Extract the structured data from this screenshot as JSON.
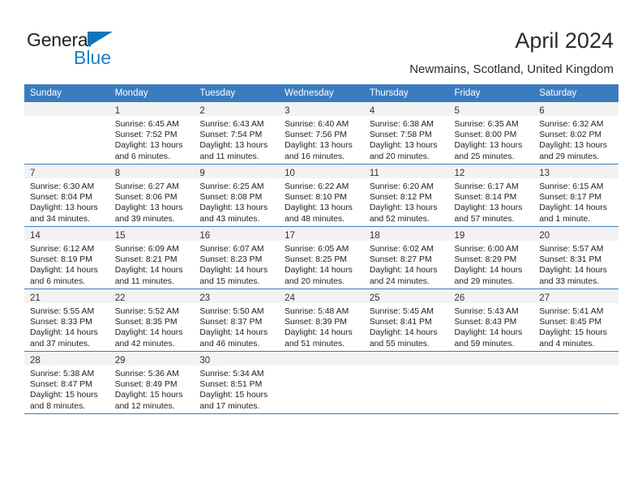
{
  "brand": {
    "name_part1": "General",
    "name_part2": "Blue",
    "triangle_color": "#1275bc",
    "text_color_primary": "#222222",
    "text_color_accent": "#1f7dc4"
  },
  "header": {
    "title": "April 2024",
    "subtitle": "Newmains, Scotland, United Kingdom"
  },
  "theme": {
    "header_row_bg": "#3b7cbf",
    "header_row_text": "#ffffff",
    "daynum_band_bg": "#f2f2f2",
    "cell_border": "#3b7cbf",
    "page_bg": "#ffffff"
  },
  "weekdays": [
    "Sunday",
    "Monday",
    "Tuesday",
    "Wednesday",
    "Thursday",
    "Friday",
    "Saturday"
  ],
  "labels": {
    "sunrise_prefix": "Sunrise:",
    "sunset_prefix": "Sunset:",
    "daylight_prefix": "Daylight:"
  },
  "weeks": [
    [
      {
        "empty": true
      },
      {
        "empty": false,
        "day": "1",
        "sunrise": "Sunrise: 6:45 AM",
        "sunset": "Sunset: 7:52 PM",
        "daylight_line1": "Daylight: 13 hours",
        "daylight_line2": "and 6 minutes."
      },
      {
        "empty": false,
        "day": "2",
        "sunrise": "Sunrise: 6:43 AM",
        "sunset": "Sunset: 7:54 PM",
        "daylight_line1": "Daylight: 13 hours",
        "daylight_line2": "and 11 minutes."
      },
      {
        "empty": false,
        "day": "3",
        "sunrise": "Sunrise: 6:40 AM",
        "sunset": "Sunset: 7:56 PM",
        "daylight_line1": "Daylight: 13 hours",
        "daylight_line2": "and 16 minutes."
      },
      {
        "empty": false,
        "day": "4",
        "sunrise": "Sunrise: 6:38 AM",
        "sunset": "Sunset: 7:58 PM",
        "daylight_line1": "Daylight: 13 hours",
        "daylight_line2": "and 20 minutes."
      },
      {
        "empty": false,
        "day": "5",
        "sunrise": "Sunrise: 6:35 AM",
        "sunset": "Sunset: 8:00 PM",
        "daylight_line1": "Daylight: 13 hours",
        "daylight_line2": "and 25 minutes."
      },
      {
        "empty": false,
        "day": "6",
        "sunrise": "Sunrise: 6:32 AM",
        "sunset": "Sunset: 8:02 PM",
        "daylight_line1": "Daylight: 13 hours",
        "daylight_line2": "and 29 minutes."
      }
    ],
    [
      {
        "empty": false,
        "day": "7",
        "sunrise": "Sunrise: 6:30 AM",
        "sunset": "Sunset: 8:04 PM",
        "daylight_line1": "Daylight: 13 hours",
        "daylight_line2": "and 34 minutes."
      },
      {
        "empty": false,
        "day": "8",
        "sunrise": "Sunrise: 6:27 AM",
        "sunset": "Sunset: 8:06 PM",
        "daylight_line1": "Daylight: 13 hours",
        "daylight_line2": "and 39 minutes."
      },
      {
        "empty": false,
        "day": "9",
        "sunrise": "Sunrise: 6:25 AM",
        "sunset": "Sunset: 8:08 PM",
        "daylight_line1": "Daylight: 13 hours",
        "daylight_line2": "and 43 minutes."
      },
      {
        "empty": false,
        "day": "10",
        "sunrise": "Sunrise: 6:22 AM",
        "sunset": "Sunset: 8:10 PM",
        "daylight_line1": "Daylight: 13 hours",
        "daylight_line2": "and 48 minutes."
      },
      {
        "empty": false,
        "day": "11",
        "sunrise": "Sunrise: 6:20 AM",
        "sunset": "Sunset: 8:12 PM",
        "daylight_line1": "Daylight: 13 hours",
        "daylight_line2": "and 52 minutes."
      },
      {
        "empty": false,
        "day": "12",
        "sunrise": "Sunrise: 6:17 AM",
        "sunset": "Sunset: 8:14 PM",
        "daylight_line1": "Daylight: 13 hours",
        "daylight_line2": "and 57 minutes."
      },
      {
        "empty": false,
        "day": "13",
        "sunrise": "Sunrise: 6:15 AM",
        "sunset": "Sunset: 8:17 PM",
        "daylight_line1": "Daylight: 14 hours",
        "daylight_line2": "and 1 minute."
      }
    ],
    [
      {
        "empty": false,
        "day": "14",
        "sunrise": "Sunrise: 6:12 AM",
        "sunset": "Sunset: 8:19 PM",
        "daylight_line1": "Daylight: 14 hours",
        "daylight_line2": "and 6 minutes."
      },
      {
        "empty": false,
        "day": "15",
        "sunrise": "Sunrise: 6:09 AM",
        "sunset": "Sunset: 8:21 PM",
        "daylight_line1": "Daylight: 14 hours",
        "daylight_line2": "and 11 minutes."
      },
      {
        "empty": false,
        "day": "16",
        "sunrise": "Sunrise: 6:07 AM",
        "sunset": "Sunset: 8:23 PM",
        "daylight_line1": "Daylight: 14 hours",
        "daylight_line2": "and 15 minutes."
      },
      {
        "empty": false,
        "day": "17",
        "sunrise": "Sunrise: 6:05 AM",
        "sunset": "Sunset: 8:25 PM",
        "daylight_line1": "Daylight: 14 hours",
        "daylight_line2": "and 20 minutes."
      },
      {
        "empty": false,
        "day": "18",
        "sunrise": "Sunrise: 6:02 AM",
        "sunset": "Sunset: 8:27 PM",
        "daylight_line1": "Daylight: 14 hours",
        "daylight_line2": "and 24 minutes."
      },
      {
        "empty": false,
        "day": "19",
        "sunrise": "Sunrise: 6:00 AM",
        "sunset": "Sunset: 8:29 PM",
        "daylight_line1": "Daylight: 14 hours",
        "daylight_line2": "and 29 minutes."
      },
      {
        "empty": false,
        "day": "20",
        "sunrise": "Sunrise: 5:57 AM",
        "sunset": "Sunset: 8:31 PM",
        "daylight_line1": "Daylight: 14 hours",
        "daylight_line2": "and 33 minutes."
      }
    ],
    [
      {
        "empty": false,
        "day": "21",
        "sunrise": "Sunrise: 5:55 AM",
        "sunset": "Sunset: 8:33 PM",
        "daylight_line1": "Daylight: 14 hours",
        "daylight_line2": "and 37 minutes."
      },
      {
        "empty": false,
        "day": "22",
        "sunrise": "Sunrise: 5:52 AM",
        "sunset": "Sunset: 8:35 PM",
        "daylight_line1": "Daylight: 14 hours",
        "daylight_line2": "and 42 minutes."
      },
      {
        "empty": false,
        "day": "23",
        "sunrise": "Sunrise: 5:50 AM",
        "sunset": "Sunset: 8:37 PM",
        "daylight_line1": "Daylight: 14 hours",
        "daylight_line2": "and 46 minutes."
      },
      {
        "empty": false,
        "day": "24",
        "sunrise": "Sunrise: 5:48 AM",
        "sunset": "Sunset: 8:39 PM",
        "daylight_line1": "Daylight: 14 hours",
        "daylight_line2": "and 51 minutes."
      },
      {
        "empty": false,
        "day": "25",
        "sunrise": "Sunrise: 5:45 AM",
        "sunset": "Sunset: 8:41 PM",
        "daylight_line1": "Daylight: 14 hours",
        "daylight_line2": "and 55 minutes."
      },
      {
        "empty": false,
        "day": "26",
        "sunrise": "Sunrise: 5:43 AM",
        "sunset": "Sunset: 8:43 PM",
        "daylight_line1": "Daylight: 14 hours",
        "daylight_line2": "and 59 minutes."
      },
      {
        "empty": false,
        "day": "27",
        "sunrise": "Sunrise: 5:41 AM",
        "sunset": "Sunset: 8:45 PM",
        "daylight_line1": "Daylight: 15 hours",
        "daylight_line2": "and 4 minutes."
      }
    ],
    [
      {
        "empty": false,
        "day": "28",
        "sunrise": "Sunrise: 5:38 AM",
        "sunset": "Sunset: 8:47 PM",
        "daylight_line1": "Daylight: 15 hours",
        "daylight_line2": "and 8 minutes."
      },
      {
        "empty": false,
        "day": "29",
        "sunrise": "Sunrise: 5:36 AM",
        "sunset": "Sunset: 8:49 PM",
        "daylight_line1": "Daylight: 15 hours",
        "daylight_line2": "and 12 minutes."
      },
      {
        "empty": false,
        "day": "30",
        "sunrise": "Sunrise: 5:34 AM",
        "sunset": "Sunset: 8:51 PM",
        "daylight_line1": "Daylight: 15 hours",
        "daylight_line2": "and 17 minutes."
      },
      {
        "empty": true
      },
      {
        "empty": true
      },
      {
        "empty": true
      },
      {
        "empty": true
      }
    ]
  ]
}
